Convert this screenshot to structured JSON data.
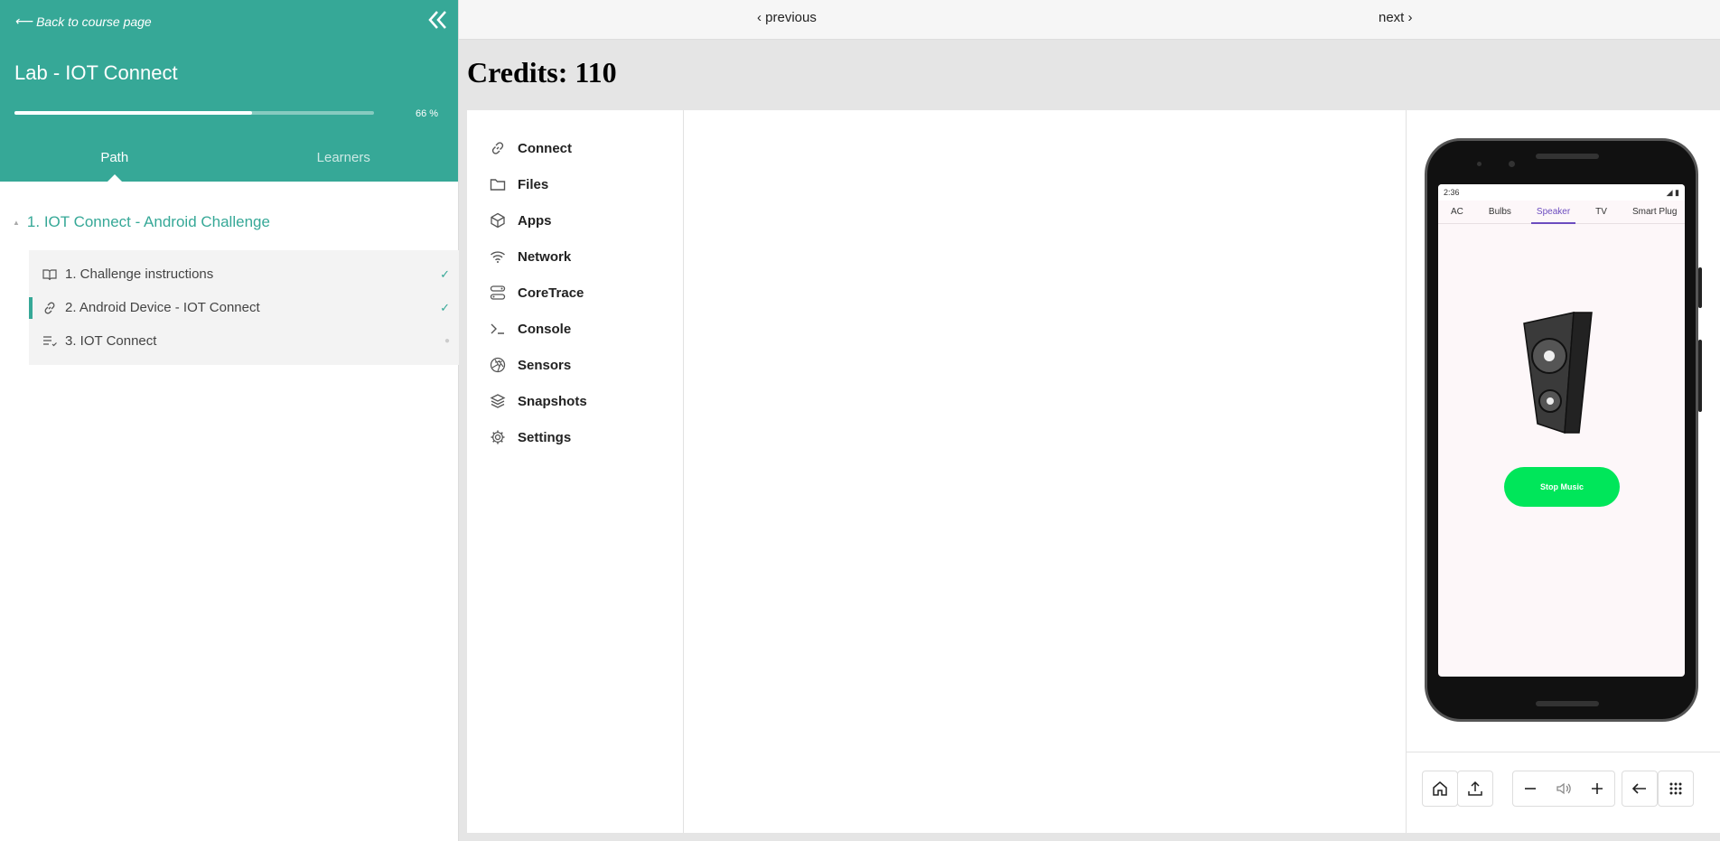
{
  "sidebar": {
    "back_label": "Back to course page",
    "course_title": "Lab - IOT Connect",
    "progress": 0.66,
    "progress_label": "66 %",
    "tabs": [
      {
        "label": "Path"
      },
      {
        "label": "Learners"
      }
    ],
    "section_title": "1. IOT Connect - Android Challenge",
    "lessons": [
      {
        "label": "1. Challenge instructions",
        "icon": "book-icon",
        "status": "✓"
      },
      {
        "label": "2. Android Device - IOT Connect",
        "icon": "link-icon",
        "status": "✓"
      },
      {
        "label": "3. IOT Connect",
        "icon": "checklist-icon",
        "status": "●"
      }
    ]
  },
  "nav": {
    "previous_label": "‹ previous",
    "next_label": "next ›"
  },
  "credits_label": "Credits: 110",
  "tools": [
    {
      "label": "Connect",
      "icon": "link-icon"
    },
    {
      "label": "Files",
      "icon": "folder-icon"
    },
    {
      "label": "Apps",
      "icon": "cube-icon"
    },
    {
      "label": "Network",
      "icon": "wifi-icon"
    },
    {
      "label": "CoreTrace",
      "icon": "trace-icon"
    },
    {
      "label": "Console",
      "icon": "terminal-icon"
    },
    {
      "label": "Sensors",
      "icon": "aperture-icon"
    },
    {
      "label": "Snapshots",
      "icon": "layers-icon"
    },
    {
      "label": "Settings",
      "icon": "gear-icon"
    }
  ],
  "phone": {
    "time": "2:36",
    "app_tabs": [
      "AC",
      "Bulbs",
      "Speaker",
      "TV",
      "Smart Plug"
    ],
    "active_tab": "Speaker",
    "stop_button_label": "Stop Music"
  },
  "colors": {
    "accent": "#36a897",
    "stop_button": "#00e65a",
    "tab_active": "#6c4cbf"
  }
}
